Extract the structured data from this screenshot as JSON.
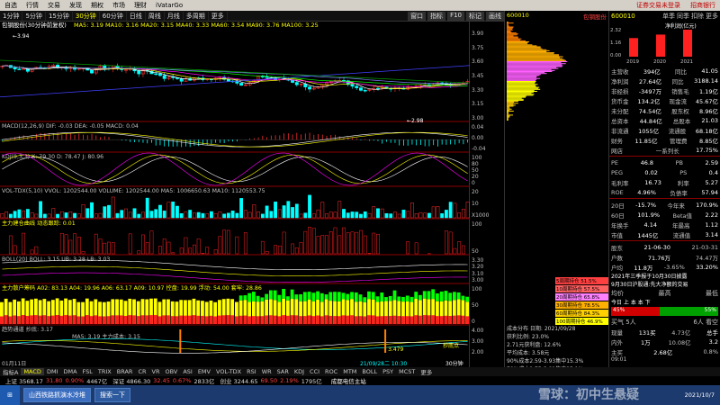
{
  "menu": {
    "items": [
      "自选",
      "行情",
      "交易",
      "发现",
      "期权",
      "市场",
      "理财",
      "iVatarGo"
    ],
    "warning": "证券交易未登录",
    "right_label": "招商银行"
  },
  "toolbar": {
    "items": [
      "1分钟",
      "5分钟",
      "15分钟",
      "30分钟",
      "60分钟",
      "日线",
      "周线",
      "月线",
      "多周期",
      "更多"
    ],
    "active": "30分钟",
    "right": [
      "窗口",
      "指标",
      "F10",
      "标记",
      "画线"
    ]
  },
  "main": {
    "title": "包钢股份(30分钟前复权)",
    "ma": "MA5: 3.19  MA10: 3.16  MA20: 3.15  MA40: 3.33  MA60: 3.54  MA90: 3.76  MA100: 3.25",
    "high_label": "3.94",
    "low_label": "2.98",
    "y_ticks": [
      "3.90",
      "3.75",
      "3.60",
      "3.45",
      "3.30",
      "3.15",
      "3.00"
    ]
  },
  "panels": {
    "macd": {
      "label": "MACD(12,26,9) DIF: -0.03  DEA: -0.05  MACD: 0.04",
      "ticks": [
        "0.04",
        "0.00",
        "-0.04"
      ]
    },
    "kdj": {
      "label": "KDJ(9,3,3) K: 79.30  D: 78.47  J: 80.96",
      "ticks": [
        "100",
        "80",
        "50",
        "20",
        "0"
      ]
    },
    "vol": {
      "label": "VOL-TDX(5,10) VVOL: 1202544.00  VOLUME: 1202544.00  MA5: 1006650.63  MA10: 1120553.75",
      "ticks": [
        "20",
        "10",
        "X1000"
      ]
    },
    "zljc": {
      "label": "主力建仓曲线  动态跟踪: 0.01",
      "ticks": [
        "100",
        "50"
      ]
    },
    "boll": {
      "label": "BOLL(20) BOLL: 3.15  UB: 3.28  LB: 3.03",
      "ticks": [
        "3.30",
        "3.20",
        "3.10",
        "3.00"
      ]
    },
    "zlsh": {
      "label": "主力散户筹码  A02: 83.13  A04: 19.96  A06: 63.17  A09: 10.97  控盘: 19.99  浮动: 54.00  套牢: 28.86",
      "ticks": [
        "100",
        "50",
        "0"
      ]
    },
    "bull": {
      "label": "趋势通道  抄底: 3.17",
      "label2": "MA5: 3.19  主力成本: 3.15",
      "ticks": [
        "4.00",
        "3.00",
        "2.00"
      ],
      "note1": "3.479",
      "note2": "抄底点"
    }
  },
  "xaxis": {
    "start": "01月11日",
    "highlight": "21/09/28二  10:30",
    "end": "30分钟"
  },
  "indicators": [
    "指标A",
    "MACD",
    "DMI",
    "DMA",
    "FSL",
    "TRIX",
    "BRAR",
    "CR",
    "VR",
    "OBV",
    "ASI",
    "EMV",
    "VOL-TDX",
    "RSI",
    "WR",
    "SAR",
    "KDJ",
    "CCI",
    "ROC",
    "MTM",
    "BOLL",
    "PSY",
    "MCST",
    "更多"
  ],
  "depth": {
    "code": "600010",
    "name": "包钢股份",
    "rows": [
      {
        "label": "5周期持仓 51.5%",
        "color": "#ff4040"
      },
      {
        "label": "10周期持仓 57.5%",
        "color": "#ff6060"
      },
      {
        "label": "20周期持仓 65.8%",
        "color": "#ff80ff"
      },
      {
        "label": "30周期持仓 78.5%",
        "color": "#ffb000"
      },
      {
        "label": "60周期持仓 84.3%",
        "color": "#ffd000"
      },
      {
        "label": "100周期持仓 46.9%",
        "color": "#ffff00"
      }
    ],
    "info": [
      "成本分布 日期: 2021/09/28",
      "获利比例: 23.0%",
      "2.71元获利盘: 12.6%",
      "平均成本: 3.58元",
      "90%成本2.59-3.93集中15.3%",
      "70%成本2.75-3.81集中25.1%"
    ]
  },
  "quote": {
    "code": "600010",
    "tabs": [
      "单季",
      "同季",
      "扣除",
      "更多"
    ],
    "chart": {
      "title": "净利润(亿元)",
      "years": [
        "2019",
        "2020",
        "2021"
      ],
      "values": [
        1.6,
        1.9,
        2.32
      ],
      "y_ticks": [
        "2.32",
        "1.16",
        "0.00"
      ]
    },
    "rows": [
      [
        "主营收",
        "394亿",
        "同比",
        "41.05"
      ],
      [
        "净利润",
        "27.64亿",
        "同比",
        "3188.14"
      ],
      [
        "非经损",
        "-3497万",
        "销售毛",
        "1.19亿"
      ],
      [
        "货币金",
        "134.2亿",
        "现金流",
        "45.67亿"
      ],
      [
        "未分配",
        "74.54亿",
        "股东权",
        "8.96亿"
      ],
      [
        "总资本",
        "44.84亿",
        "总股本",
        "21.03"
      ],
      [
        "非流通",
        "1055亿",
        "流通股",
        "68.18亿"
      ],
      [
        "财务",
        "11.85亿",
        "管理费",
        "8.85亿"
      ],
      [
        "网店",
        "",
        "一系列长",
        "17.75%"
      ]
    ],
    "rows2": [
      [
        "PE",
        "46.8",
        "PB",
        "2.59"
      ],
      [
        "PEG",
        "0.02",
        "PS",
        "0.4"
      ],
      [
        "毛利率",
        "16.73",
        "利率",
        "5.27"
      ],
      [
        "ROE",
        "4.96%",
        "负债率",
        "57.94"
      ]
    ],
    "rows3": [
      [
        "20日",
        "-15.7%",
        "今年来",
        "170.9%"
      ],
      [
        "60日",
        "101.9%",
        "Beta值",
        "2.22"
      ],
      [
        "年换手",
        "4.14",
        "年最高",
        "1.12"
      ],
      [
        "市值",
        "1445亿",
        "流通值",
        "3.14"
      ]
    ],
    "rows4": [
      [
        "股东",
        "21-06-30",
        "21-03-31"
      ],
      [
        "户数",
        "71.76万",
        "74.47万"
      ],
      [
        "户均",
        "11.8万",
        "-3.65%",
        "33.20%"
      ]
    ],
    "notice": [
      "2021年三季报于10月30日披露",
      "9月30日沪股通:先大净额的交易"
    ],
    "trade": {
      "labels": [
        "均价",
        "最高",
        "最低"
      ],
      "mid": "今日 上 本 本 下",
      "buy": "45%",
      "sell": "55%",
      "vol_row": [
        "买气 5人",
        "6人 看空"
      ]
    },
    "levels": [
      [
        "现量",
        "131买",
        "4.73亿",
        "总手"
      ],
      [
        "内外",
        "1万",
        "10.08亿",
        "3.2"
      ],
      [
        "主买",
        "2.68亿",
        "0.8%"
      ]
    ],
    "last": "09:01"
  },
  "status": {
    "sh": "上证 3568.17",
    "sh_chg": "31.80",
    "sh_pct": "0.90%",
    "sh_amt": "4467亿",
    "sz": "深证 4866.30",
    "sz_chg": "32.45",
    "sz_pct": "0.67%",
    "sz_amt": "2833亿",
    "cy": "创业 3244.65",
    "cy_chg": "69.50",
    "cy_pct": "2.19%",
    "cy_amt": "1795亿",
    "news": "成都电信主站"
  },
  "taskbar": {
    "tasks": [
      "山西铁路抓演水冷堆",
      "搜索一下"
    ],
    "date": "2021/10/7",
    "watermark": "雪球：初中生悬疑"
  }
}
